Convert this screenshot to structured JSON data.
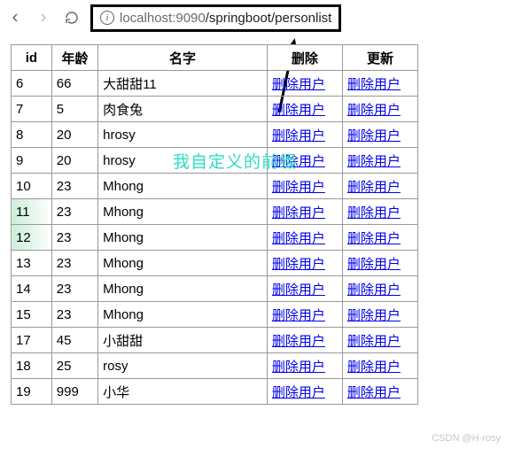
{
  "browser": {
    "url_host": "localhost",
    "url_port": ":9090",
    "url_path": "/springboot/personlist"
  },
  "annotation": {
    "text": "我自定义的前缀"
  },
  "table": {
    "headers": {
      "id": "id",
      "age": "年龄",
      "name": "名字",
      "delete": "删除",
      "update": "更新"
    },
    "action_labels": {
      "delete": "删除用户",
      "update": "删除用户"
    },
    "rows": [
      {
        "id": "6",
        "age": "66",
        "name": "大甜甜11"
      },
      {
        "id": "7",
        "age": "5",
        "name": "肉食兔"
      },
      {
        "id": "8",
        "age": "20",
        "name": "hrosy"
      },
      {
        "id": "9",
        "age": "20",
        "name": "hrosy"
      },
      {
        "id": "10",
        "age": "23",
        "name": "Mhong"
      },
      {
        "id": "11",
        "age": "23",
        "name": "Mhong"
      },
      {
        "id": "12",
        "age": "23",
        "name": "Mhong"
      },
      {
        "id": "13",
        "age": "23",
        "name": "Mhong"
      },
      {
        "id": "14",
        "age": "23",
        "name": "Mhong"
      },
      {
        "id": "15",
        "age": "23",
        "name": "Mhong"
      },
      {
        "id": "17",
        "age": "45",
        "name": "小甜甜"
      },
      {
        "id": "18",
        "age": "25",
        "name": "rosy"
      },
      {
        "id": "19",
        "age": "999",
        "name": "小华"
      }
    ]
  },
  "watermark": "CSDN @H·rosy"
}
